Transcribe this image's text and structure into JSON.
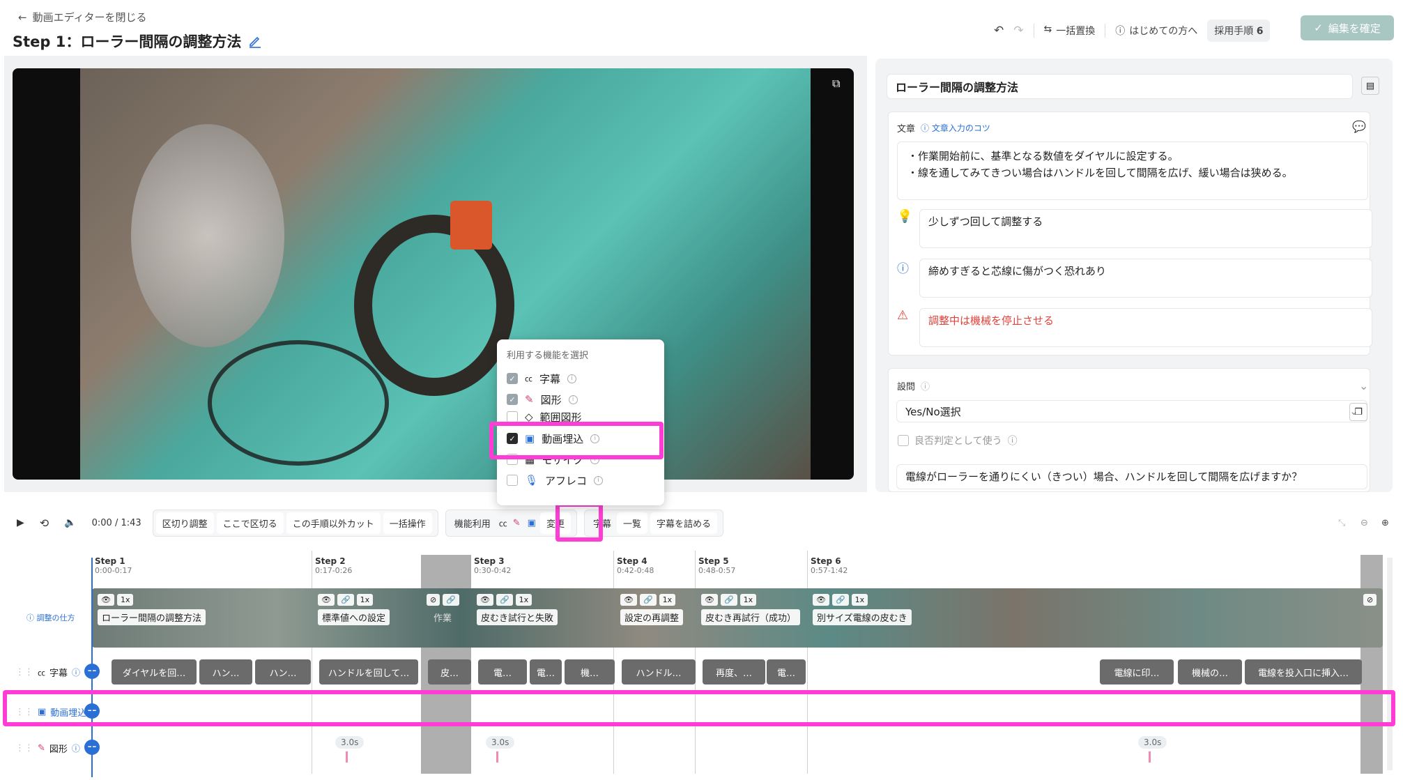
{
  "header": {
    "back_label": "動画エディターを閉じる",
    "title": "Step 1：ローラー間隔の調整方法",
    "bulk_replace": "一括置換",
    "first_time": "はじめての方へ",
    "adopted_steps": "採用手順",
    "adopted_count": "6",
    "confirm": "編集を確定"
  },
  "sidebar": {
    "step_title": "ローラー間隔の調整方法",
    "text_label": "文章",
    "text_tip_link": "文章入力のコツ",
    "text_line1": "・作業開始前に、基準となる数値をダイヤルに設定する。",
    "text_line2": "・線を通してみてきつい場合はハンドルを回して間隔を広げ、緩い場合は狭める。",
    "tip_hint": "少しずつ回して調整する",
    "tip_info": "締めすぎると芯線に傷がつく恐れあり",
    "tip_warning": "調整中は機械を停止させる",
    "question_label": "設問",
    "question_type": "Yes/No選択",
    "pass_fail_label": "良否判定として使う",
    "question_text": "電線がローラーを通りにくい（きつい）場合、ハンドルを回して間隔を広げますか？"
  },
  "controls": {
    "time": "0:00 / 1:43",
    "split_adjust": "区切り調整",
    "split_here": "ここで区切る",
    "cut_others": "この手順以外カット",
    "bulk_ops": "一括操作",
    "feature_use": "機能利用",
    "change": "変更",
    "subtitle": "字幕",
    "list": "一覧",
    "pack_subtitles": "字幕を詰める"
  },
  "feature_popup": {
    "title": "利用する機能を選択",
    "items": [
      {
        "label": "字幕",
        "checked": true
      },
      {
        "label": "図形",
        "checked": true
      },
      {
        "label": "範囲図形",
        "checked": false
      },
      {
        "label": "動画埋込",
        "checked": true
      },
      {
        "label": "モザイク",
        "checked": false
      },
      {
        "label": "アフレコ",
        "checked": false
      }
    ]
  },
  "timeline": {
    "how_to_label": "調整の仕方",
    "steps": [
      {
        "label": "Step 1",
        "time": "0:00-0:17",
        "caption": "ローラー間隔の調整方法"
      },
      {
        "label": "Step 2",
        "time": "0:17-0:26",
        "caption": "標準値への設定"
      },
      {
        "label": "Step 3",
        "time": "0:30-0:42",
        "caption": "皮むき試行と失敗"
      },
      {
        "label": "Step 4",
        "time": "0:42-0:48",
        "caption": "設定の再調整"
      },
      {
        "label": "Step 5",
        "time": "0:48-0:57",
        "caption": "皮むき再試行（成功）"
      },
      {
        "label": "Step 6",
        "time": "0:57-1:42",
        "caption": "別サイズ電線の皮むき"
      }
    ],
    "speed": "1x",
    "cut_label": "作業",
    "rows": {
      "subtitle": "字幕",
      "video_embed": "動画埋込",
      "shape": "図形"
    },
    "subtitles": [
      "ダイヤルを回…",
      "ハン…",
      "ハン…",
      "ハンドルを回して…",
      "皮…",
      "電…",
      "電…",
      "機…",
      "ハンドル…",
      "再度、…",
      "電…",
      "電線に印…",
      "機械の…",
      "電線を投入口に挿入…"
    ],
    "shape_duration": "3.0s"
  }
}
